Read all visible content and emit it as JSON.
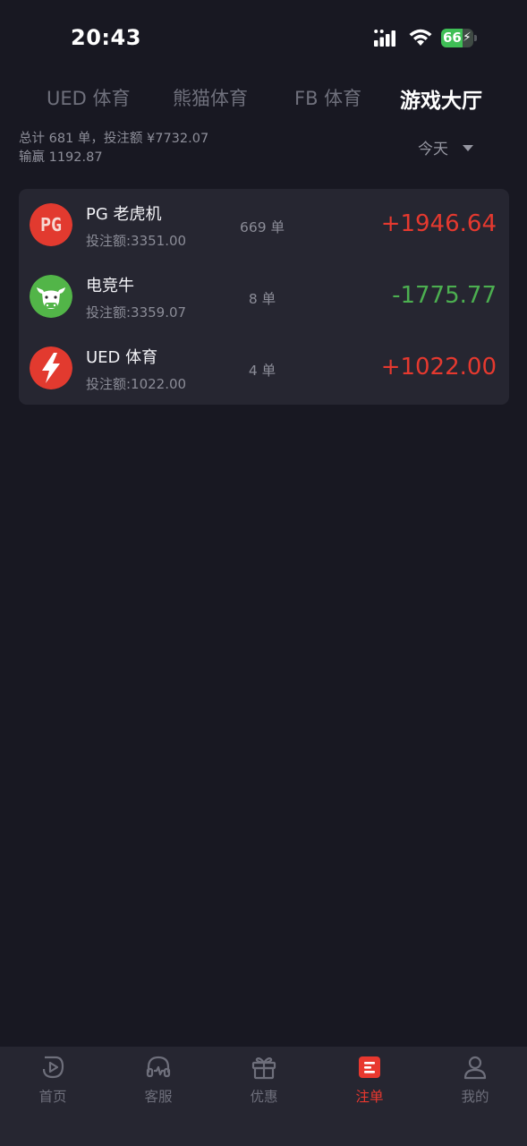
{
  "status_bar": {
    "time": "20:43",
    "battery_level": 66,
    "battery_text": "66",
    "charging": true,
    "icons": [
      "signal-icon",
      "wifi-icon",
      "battery-icon"
    ]
  },
  "tabs": [
    {
      "label": "UED 体育",
      "active": false
    },
    {
      "label": "熊猫体育",
      "active": false
    },
    {
      "label": "FB 体育",
      "active": false
    },
    {
      "label": "游戏大厅",
      "active": true
    }
  ],
  "summary": {
    "line1": "总计 681 单，投注额  ¥7732.07",
    "line2": "输赢 1192.87"
  },
  "date_filter": {
    "label": "今天",
    "icon": "caret-down-icon"
  },
  "colors": {
    "background": "#181822",
    "card": "#262631",
    "profit_positive": "#e5392f",
    "profit_negative": "#4caf50",
    "accent": "#e8382f"
  },
  "records": [
    {
      "name": "PG 老虎机",
      "bet": "投注额:3351.00",
      "count": "669 单",
      "profit": "+1946.64",
      "icon": "pg-logo-icon",
      "logo_text": "PG"
    },
    {
      "name": "电竞牛",
      "bet": "投注额:3359.07",
      "count": "8 单",
      "profit": "-1775.77",
      "icon": "bull-logo-icon"
    },
    {
      "name": "UED 体育",
      "bet": "投注额:1022.00",
      "count": "4 单",
      "profit": "+1022.00",
      "icon": "lightning-logo-icon"
    }
  ],
  "nav": [
    {
      "label": "首页",
      "icon": "home-icon",
      "active": false
    },
    {
      "label": "客服",
      "icon": "headset-icon",
      "active": false
    },
    {
      "label": "优惠",
      "icon": "gift-icon",
      "active": false
    },
    {
      "label": "注单",
      "icon": "bet-slip-icon",
      "active": true
    },
    {
      "label": "我的",
      "icon": "user-icon",
      "active": false
    }
  ]
}
